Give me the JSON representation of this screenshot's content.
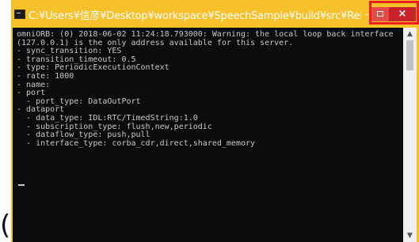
{
  "window": {
    "title": "C:¥Users¥信彦¥Desktop¥workspace¥SpeechSample¥build¥src¥Release...",
    "controls": {
      "minimize": "–",
      "close": "×"
    }
  },
  "console": {
    "lines": [
      "omniORB: (0) 2018-06-02 11:24:18.793000: Warning: the local loop back interface",
      "(127.0.0.1) is the only address available for this server.",
      "- sync_transition: YES",
      "- transition_timeout: 0.5",
      "- type: PeriodicExecutionContext",
      "- rate: 1000",
      "- name:",
      "- port",
      "  - port_type: DataOutPort",
      "- dataport",
      "  - data_type: IDL:RTC/TimedString:1.0",
      "  - subscription_type: flush,new,periodic",
      "  - dataflow_type: push,pull",
      "  - interface_type: corba_cdr,direct,shared_memory"
    ]
  },
  "scrollbar": {
    "up_arrow": "▲",
    "down_arrow": "▼",
    "position_fraction": 0.0
  },
  "background": {
    "partial_text": "(",
    "accent_color": "#f6c12b",
    "close_color": "#c8232b",
    "highlight_color": "#ea2020"
  }
}
